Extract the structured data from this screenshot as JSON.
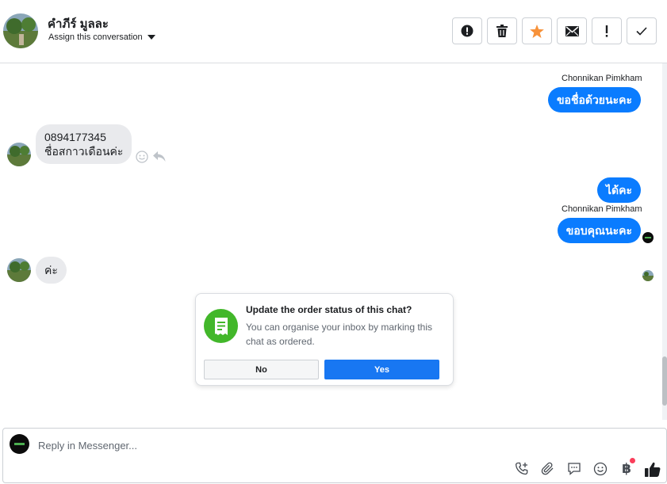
{
  "header": {
    "contact_name": "คำภีร์ มูลละ",
    "assign_label": "Assign this conversation",
    "actions": [
      {
        "name": "spam-button",
        "icon": "alert-circle-icon"
      },
      {
        "name": "delete-button",
        "icon": "trash-icon"
      },
      {
        "name": "star-button",
        "icon": "star-icon"
      },
      {
        "name": "mark-unread-button",
        "icon": "envelope-icon"
      },
      {
        "name": "follow-up-button",
        "icon": "exclamation-icon"
      },
      {
        "name": "mark-done-button",
        "icon": "check-icon"
      }
    ]
  },
  "messages": [
    {
      "from": "page",
      "sender": "Chonnikan Pimkham",
      "text": "ขอชื่อด้วยนะคะ"
    },
    {
      "from": "customer",
      "lines": [
        "0894177345",
        "ชื่อสกาวเดือนค่ะ"
      ]
    },
    {
      "from": "page",
      "text": "ได้คะ"
    },
    {
      "from": "page",
      "sender": "Chonnikan Pimkham",
      "text": "ขอบคุณนะคะ"
    },
    {
      "from": "customer",
      "text": "ค่ะ"
    }
  ],
  "order_card": {
    "title": "Update the order status of this chat?",
    "description": "You can organise your inbox by marking this chat as ordered.",
    "no_label": "No",
    "yes_label": "Yes"
  },
  "composer": {
    "placeholder": "Reply in Messenger...",
    "tools": [
      "phone-plus-icon",
      "paperclip-icon",
      "saved-reply-icon",
      "emoji-icon",
      "baht-payment-icon",
      "thumbs-up-icon"
    ]
  },
  "colors": {
    "outgoing_bubble": "#0a7cff",
    "incoming_bubble": "#e9eaed",
    "yes_button": "#1877f2",
    "order_icon_bg": "#42b72a",
    "star": "#f7923a"
  }
}
